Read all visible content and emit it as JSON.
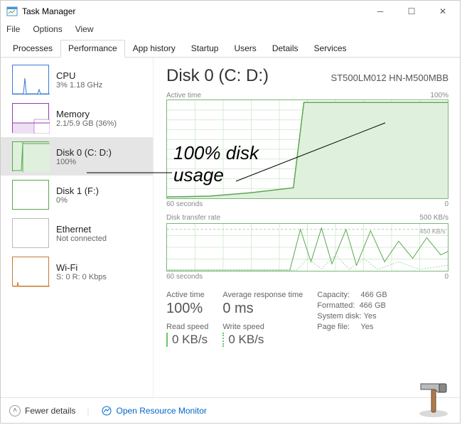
{
  "window": {
    "title": "Task Manager"
  },
  "menu": {
    "file": "File",
    "options": "Options",
    "view": "View"
  },
  "tabs": {
    "processes": "Processes",
    "performance": "Performance",
    "app_history": "App history",
    "startup": "Startup",
    "users": "Users",
    "details": "Details",
    "services": "Services"
  },
  "sidebar": {
    "items": [
      {
        "name": "CPU",
        "sub": "3%  1.18 GHz",
        "color": "#3b78d8",
        "fill": "#d7e4f7"
      },
      {
        "name": "Memory",
        "sub": "2.1/5.9 GB (36%)",
        "color": "#8e3ea8",
        "fill": "#efdff5"
      },
      {
        "name": "Disk 0 (C: D:)",
        "sub": "100%",
        "color": "#5aa64e",
        "fill": "#dff0dd"
      },
      {
        "name": "Disk 1 (F:)",
        "sub": "0%",
        "color": "#5aa64e",
        "fill": "#fff"
      },
      {
        "name": "Ethernet",
        "sub": "Not connected",
        "color": "#bbb",
        "fill": "#fff"
      },
      {
        "name": "Wi-Fi",
        "sub": "S: 0 R: 0 Kbps",
        "color": "#c8792e",
        "fill": "#fff"
      }
    ]
  },
  "main": {
    "title": "Disk 0 (C: D:)",
    "model": "ST500LM012 HN-M500MBB",
    "graph1": {
      "label": "Active time",
      "max": "100%",
      "left": "60 seconds",
      "right": "0"
    },
    "graph2": {
      "label": "Disk transfer rate",
      "max": "500 KB/s",
      "peak": "450 KB/s",
      "left": "60 seconds",
      "right": "0"
    },
    "stats": {
      "active_time_label": "Active time",
      "active_time": "100%",
      "avg_resp_label": "Average response time",
      "avg_resp": "0 ms",
      "read_label": "Read speed",
      "read": "0 KB/s",
      "write_label": "Write speed",
      "write": "0 KB/s",
      "capacity_label": "Capacity:",
      "capacity": "466 GB",
      "formatted_label": "Formatted:",
      "formatted": "466 GB",
      "sysdisk_label": "System disk:",
      "sysdisk": "Yes",
      "pagefile_label": "Page file:",
      "pagefile": "Yes"
    }
  },
  "footer": {
    "fewer": "Fewer details",
    "orm": "Open Resource Monitor"
  },
  "annotation": {
    "line1": "100% disk",
    "line2": "usage"
  },
  "chart_data": [
    {
      "type": "line",
      "title": "Active time",
      "ylabel": "%",
      "ylim": [
        0,
        100
      ],
      "xrange_seconds": [
        60,
        0
      ],
      "series": [
        {
          "name": "Active time",
          "values_pct_over_time": "rises to 100% and stays flat at 100% for latter half"
        }
      ],
      "approx_points": [
        [
          0,
          2
        ],
        [
          10,
          5
        ],
        [
          20,
          8
        ],
        [
          28,
          15
        ],
        [
          32,
          100
        ],
        [
          60,
          100
        ]
      ]
    },
    {
      "type": "line",
      "title": "Disk transfer rate",
      "ylabel": "KB/s",
      "ylim": [
        0,
        500
      ],
      "xrange_seconds": [
        60,
        0
      ],
      "annotation": "450 KB/s peak dashed line",
      "approx_points": [
        [
          0,
          0
        ],
        [
          25,
          0
        ],
        [
          30,
          420
        ],
        [
          33,
          60
        ],
        [
          36,
          440
        ],
        [
          40,
          80
        ],
        [
          44,
          430
        ],
        [
          48,
          50
        ],
        [
          52,
          300
        ],
        [
          56,
          120
        ],
        [
          60,
          200
        ]
      ]
    }
  ]
}
